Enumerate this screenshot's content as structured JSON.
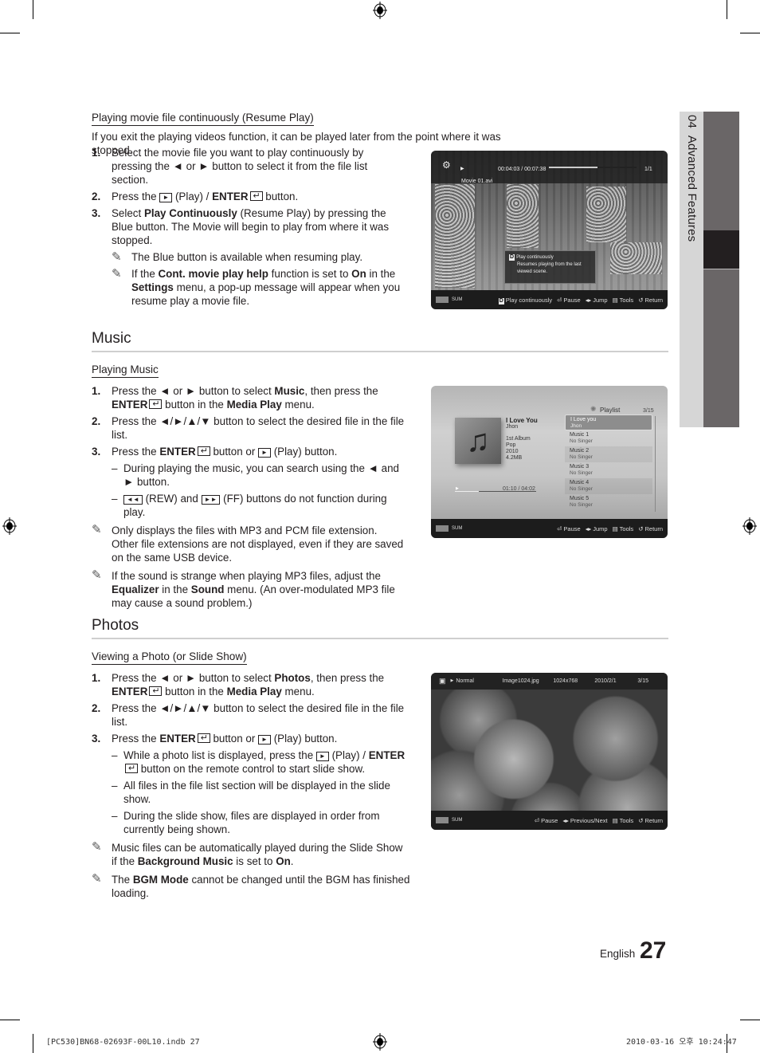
{
  "side_tab": {
    "chapter": "04",
    "title": "Advanced Features"
  },
  "resume_play": {
    "subhead": "Playing movie file continuously (Resume Play)",
    "intro": "If you exit the playing videos function, it can be played later from the point where it was stopped.",
    "steps": [
      {
        "num": "1.",
        "text": "Select the movie file you want to play continuously by pressing the ◄ or ► button to select it from the file list section."
      },
      {
        "num": "2.",
        "pre": "Press the",
        "play_key": "►",
        "mid": "(Play) /",
        "enter": "ENTER",
        "post": "button."
      },
      {
        "num": "3.",
        "pre": "Select",
        "bold": "Play Continuously",
        "post": "(Resume Play) by pressing the Blue button. The Movie will begin to play from where it was stopped."
      }
    ],
    "notes": [
      {
        "text": "The Blue button is available when resuming play."
      },
      {
        "pre": "If the",
        "b1": "Cont. movie play help",
        "mid1": "function is set to",
        "b2": "On",
        "mid2": "in the",
        "b3": "Settings",
        "post": "menu, a pop-up message will appear when you resume play a movie file."
      }
    ],
    "screen": {
      "time": "00:04:03 / 00:07:38",
      "progress": 0.55,
      "counter": "1/1",
      "filename": "Movie 01.avi",
      "popup_title": "Play continuously",
      "popup_body": "Resumes playing from the last viewed scene.",
      "sum_label": "SUM",
      "controls": [
        "Play continuously",
        "Pause",
        "Jump",
        "Tools",
        "Return"
      ]
    }
  },
  "music": {
    "title": "Music",
    "subhead": "Playing Music",
    "steps": [
      {
        "num": "1.",
        "pre": "Press the ◄ or ► button to select",
        "bold": "Music",
        "mid": ", then press the",
        "enter": "ENTER",
        "post1": "button in the",
        "bold2": "Media Play",
        "post2": "menu."
      },
      {
        "num": "2.",
        "text": "Press the ◄/►/▲/▼ button to select the desired file in the file list."
      },
      {
        "num": "3.",
        "pre": "Press the",
        "enter": "ENTER",
        "mid": "button or",
        "play_key": "►",
        "post": "(Play) button."
      }
    ],
    "dashes": [
      {
        "text": "During playing the music, you can search using the ◄ and ► button."
      },
      {
        "rew_key": "◄◄",
        "mid": "(REW) and",
        "ff_key": "►►",
        "post": "(FF) buttons do not function during play."
      }
    ],
    "notes": [
      {
        "text": "Only displays the files with MP3 and PCM file extension. Other file extensions are not displayed, even if they are saved on the same USB device."
      },
      {
        "pre": "If the sound is strange when playing MP3 files, adjust the",
        "b1": "Equalizer",
        "mid": "in the",
        "b2": "Sound",
        "post": "menu. (An over-modulated MP3 file may cause a sound problem.)"
      }
    ],
    "screen": {
      "playlist_label": "Playlist",
      "counter": "3/15",
      "track_title": "I Love You",
      "artist": "Jhon",
      "album": "1st Album",
      "genre": "Pop",
      "year": "2010",
      "size": "4.2MB",
      "time": "01:10 / 04:02",
      "progress": 0.29,
      "playlist": [
        {
          "title": "I Love you",
          "singer": "Jhon",
          "active": true
        },
        {
          "title": "Music 1",
          "singer": "No Singer"
        },
        {
          "title": "Music 2",
          "singer": "No Singer"
        },
        {
          "title": "Music 3",
          "singer": "No Singer"
        },
        {
          "title": "Music 4",
          "singer": "No Singer"
        },
        {
          "title": "Music 5",
          "singer": "No Singer"
        }
      ],
      "sum_label": "SUM",
      "controls": [
        "Pause",
        "Jump",
        "Tools",
        "Return"
      ]
    }
  },
  "photos": {
    "title": "Photos",
    "subhead": "Viewing a Photo (or Slide Show)",
    "steps": [
      {
        "num": "1.",
        "pre": "Press the ◄ or ► button to select",
        "bold": "Photos",
        "mid": ", then press the",
        "enter": "ENTER",
        "post1": "button in the",
        "bold2": "Media Play",
        "post2": "menu."
      },
      {
        "num": "2.",
        "text": "Press the ◄/►/▲/▼ button to select the desired file in the file list."
      },
      {
        "num": "3.",
        "pre": "Press the",
        "enter": "ENTER",
        "mid": "button or",
        "play_key": "►",
        "post": "(Play) button."
      }
    ],
    "dashes": [
      {
        "pre": "While a photo list is displayed, press the",
        "play_key": "►",
        "mid": "(Play) /",
        "enter": "ENTER",
        "post": "button on the remote control to start slide show."
      },
      {
        "text": "All files in the file list section will be displayed in the slide show."
      },
      {
        "text": "During the slide show, files are displayed in order from currently being shown."
      }
    ],
    "notes": [
      {
        "pre": "Music files can be automatically played during the Slide Show if the",
        "b1": "Background Music",
        "mid": "is set to",
        "b2": "On",
        "post": "."
      },
      {
        "pre": "The",
        "b1": "BGM Mode",
        "post": "cannot be changed until the BGM has finished loading."
      }
    ],
    "screen": {
      "mode": "Normal",
      "filename": "Image1024.jpg",
      "resolution": "1024x768",
      "date": "2010/2/1",
      "counter": "3/15",
      "sum_label": "SUM",
      "controls": [
        "Pause",
        "Previous/Next",
        "Tools",
        "Return"
      ]
    }
  },
  "footer": {
    "language": "English",
    "page_number": "27",
    "slug_left": "[PC530]BN68-02693F-00L10.indb   27",
    "slug_right": "2010-03-16   오후 10:24:47"
  }
}
